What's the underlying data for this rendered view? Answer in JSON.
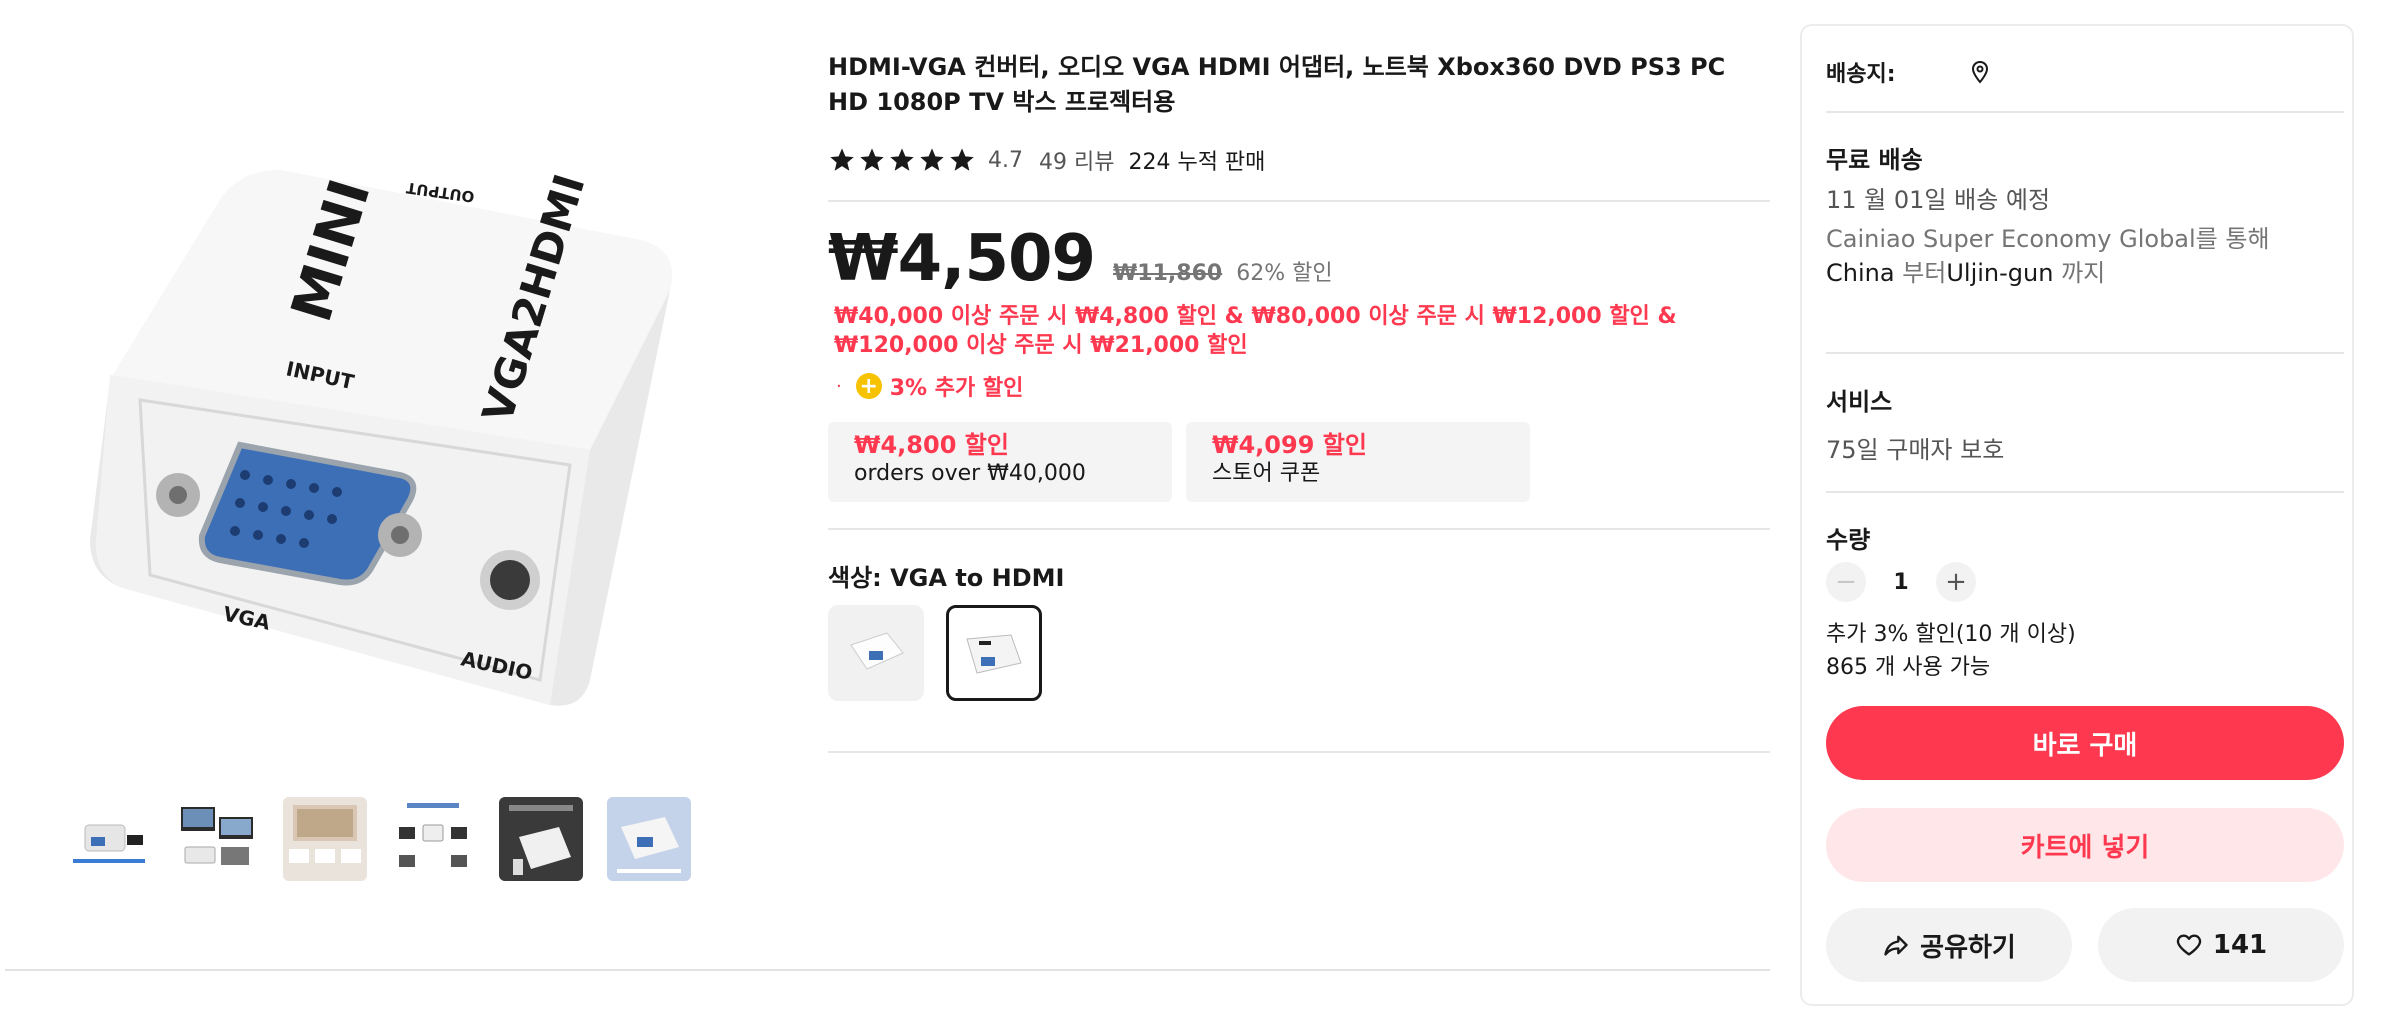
{
  "product": {
    "title": "HDMI-VGA 컨버터, 오디오 VGA HDMI 어댑터, 노트북 Xbox360 DVD PS3 PC HD 1080P TV 박스 프로젝터용",
    "rating": "4.7",
    "reviews": "49 리뷰",
    "sold": "224 누적 판매",
    "price": "₩4,509",
    "original_price": "₩11,860",
    "discount": "62% 할인",
    "promo_text": "₩40,000 이상 주문 시 ₩4,800 할인 & ₩80,000 이상 주문 시 ₩12,000 할인 & ₩120,000 이상 주문 시 ₩21,000 할인",
    "extra_discount_dot": "·",
    "extra_discount": "3% 추가 할인",
    "coupons": [
      {
        "amount": "₩4,800 할인",
        "desc": "orders over ₩40,000"
      },
      {
        "amount": "₩4,099 할인",
        "desc": "스토어 쿠폰"
      }
    ],
    "color_label": "색상: VGA to HDMI",
    "image_labels": {
      "mini": "MINI",
      "model": "VGA2HDMI",
      "output": "OUTPUT",
      "input": "INPUT",
      "vga": "VGA",
      "audio": "AUDIO"
    }
  },
  "panel": {
    "ship_to_label": "배송지:",
    "free_shipping": "무료 배송",
    "delivery_date": "11 월 01일 배송 예정",
    "route": {
      "carrier": "Cainiao Super Economy Global를 통해 ",
      "origin": "China",
      "from": " 부터",
      "dest": "Uljin-gun",
      "to": " 까지"
    },
    "service_title": "서비스",
    "service_text": "75일 구매자 보호",
    "qty_title": "수량",
    "qty_minus": "−",
    "qty_value": "1",
    "qty_plus": "+",
    "qty_note_1": "추가 3% 할인(10 개 이상)",
    "qty_note_2": "865 개 사용 가능",
    "buy_now": "바로 구매",
    "add_to_cart": "카트에 넣기",
    "share": "공유하기",
    "likes": "141"
  },
  "colors": {
    "accent": "#fd384f",
    "accent_light": "#ffe7e9",
    "coin": "#f7c200",
    "text": "#191919",
    "muted": "#757575"
  },
  "icons": {
    "star": "star-icon",
    "pin": "location-pin-icon",
    "share": "share-icon",
    "heart": "heart-icon",
    "coin": "coin-icon"
  }
}
